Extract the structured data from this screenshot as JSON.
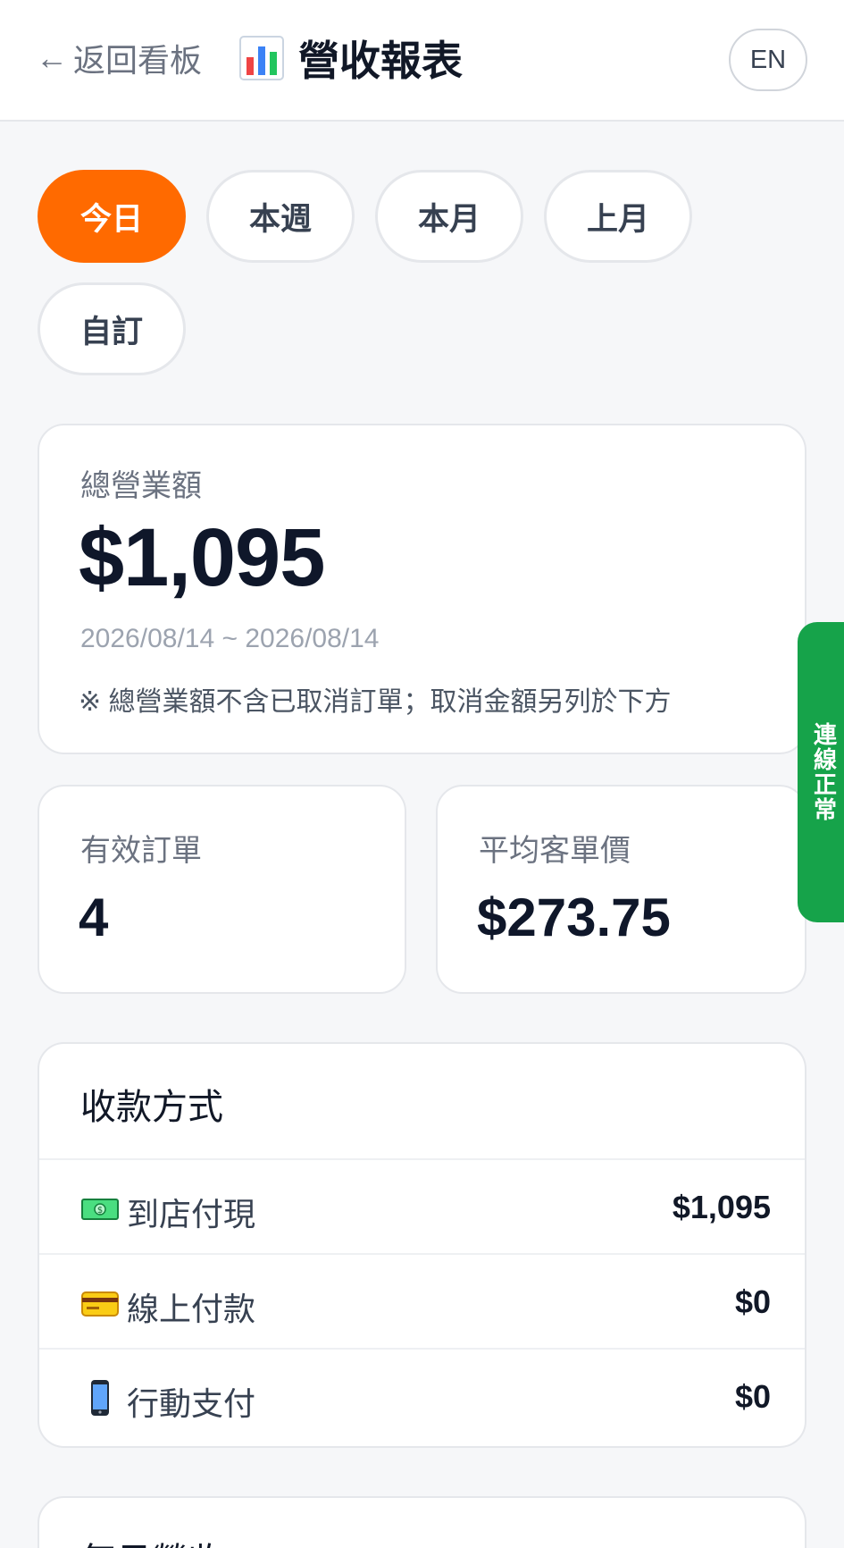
{
  "header": {
    "back_arrow": "←",
    "back_label": "返回看板",
    "title_icon": "bar-chart-icon",
    "title": "營收報表",
    "lang_button": "EN"
  },
  "period_tabs": [
    {
      "label": "今日",
      "active": true
    },
    {
      "label": "本週",
      "active": false
    },
    {
      "label": "本月",
      "active": false
    },
    {
      "label": "上月",
      "active": false
    },
    {
      "label": "自訂",
      "active": false
    }
  ],
  "summary": {
    "total_label": "總營業額",
    "total_value": "$1,095",
    "date_range": "2026/08/14 ~ 2026/08/14",
    "note": "※ 總營業額不含已取消訂單；取消金額另列於下方"
  },
  "stats": {
    "orders_label": "有效訂單",
    "orders_value": "4",
    "avg_label": "平均客單價",
    "avg_value": "$273.75"
  },
  "payment": {
    "title": "收款方式",
    "rows": [
      {
        "icon": "cash-icon",
        "name": "到店付現",
        "amount": "$1,095"
      },
      {
        "icon": "credit-card-icon",
        "name": "線上付款",
        "amount": "$0"
      },
      {
        "icon": "mobile-phone-icon",
        "name": "行動支付",
        "amount": "$0"
      }
    ]
  },
  "daily": {
    "title": "每日營收"
  },
  "connection_status": "連線正常",
  "colors": {
    "accent": "#ff6a00",
    "status_green": "#16a34a"
  }
}
